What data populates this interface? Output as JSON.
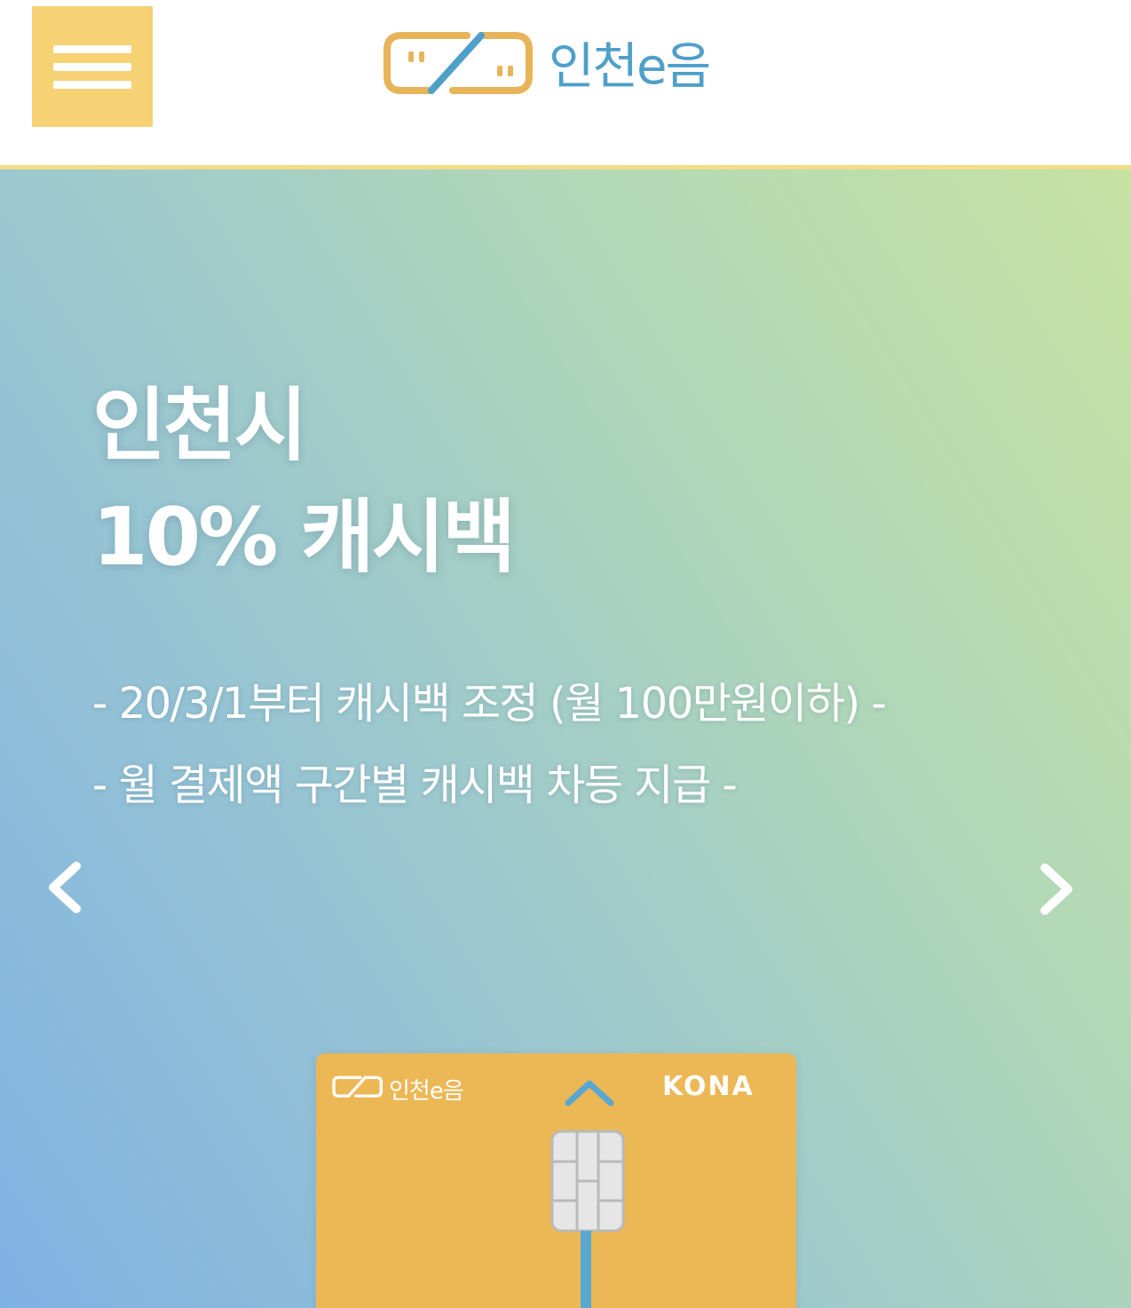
{
  "header": {
    "menu_icon": "hamburger-menu-icon",
    "brand_name": "인천e음",
    "brand_colors": {
      "logo_outline": "#e8b45a",
      "text": "#4ea0c9",
      "accent": "#f6d274"
    }
  },
  "hero": {
    "title_line1": "인천시",
    "title_line2": "10% 캐시백",
    "sub_line1": "- 20/3/1부터 캐시백 조정 (월 100만원이하) -",
    "sub_line2": "- 월 결제액 구간별 캐시백 차등 지급 -",
    "prev_icon": "chevron-left-icon",
    "next_icon": "chevron-right-icon",
    "gradient": [
      "#7fb2e4",
      "#9cc8cf",
      "#b2d8b6",
      "#c6e3a3"
    ]
  },
  "card": {
    "logo_text": "인천e음",
    "brand": "KONA",
    "color": "#ecb755",
    "chevron_icon": "chevron-up-icon",
    "chip_icon": "card-chip-icon"
  }
}
